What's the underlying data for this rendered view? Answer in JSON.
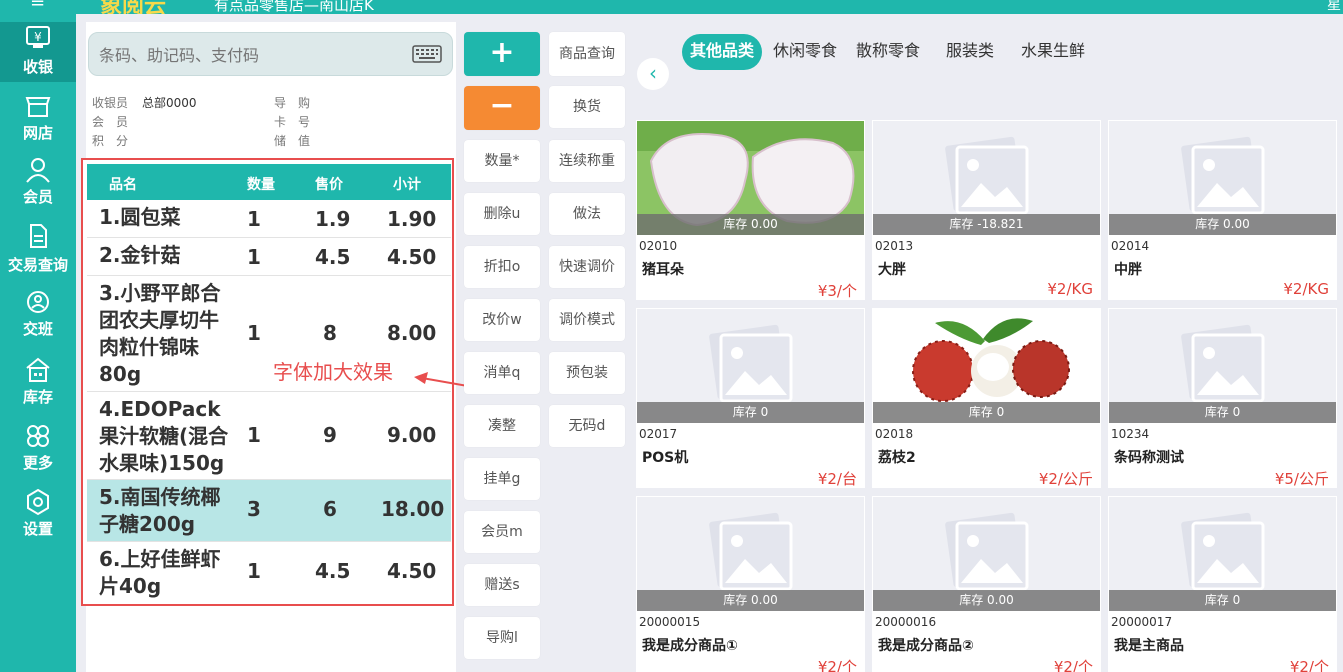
{
  "header": {
    "menu_icon": "hamburger-icon",
    "brand": "象阅云",
    "store": "有点品零售店—南山店K",
    "right_text": "星"
  },
  "nav": [
    {
      "label": "收银",
      "icon": "cashier-icon",
      "active": true
    },
    {
      "label": "网店",
      "icon": "store-icon",
      "active": false
    },
    {
      "label": "会员",
      "icon": "member-icon",
      "active": false
    },
    {
      "label": "交易查询",
      "icon": "document-icon",
      "active": false
    },
    {
      "label": "交班",
      "icon": "shift-icon",
      "active": false
    },
    {
      "label": "库存",
      "icon": "warehouse-icon",
      "active": false
    },
    {
      "label": "更多",
      "icon": "more-icon",
      "active": false
    },
    {
      "label": "设置",
      "icon": "settings-icon",
      "active": false
    }
  ],
  "search": {
    "placeholder": "条码、助记码、支付码",
    "icon": "keyboard-icon"
  },
  "info": {
    "cashier_label": "收银员",
    "cashier_value": "总部0000",
    "guide_label": "导　购",
    "member_label": "会　员",
    "card_label": "卡　号",
    "points_label": "积　分",
    "balance_label": "储　值"
  },
  "cart": {
    "headers": {
      "name": "品名",
      "qty": "数量",
      "price": "售价",
      "subtotal": "小计"
    },
    "rows": [
      {
        "name": "1.圆包菜",
        "qty": "1",
        "price": "1.9",
        "subtotal": "1.90"
      },
      {
        "name": "2.金针菇",
        "qty": "1",
        "price": "4.5",
        "subtotal": "4.50"
      },
      {
        "name": "3.小野平郎合团农夫厚切牛肉粒什锦味80g",
        "qty": "1",
        "price": "8",
        "subtotal": "8.00"
      },
      {
        "name": "4.EDOPack果汁软糖(混合水果味)150g",
        "qty": "1",
        "price": "9",
        "subtotal": "9.00"
      },
      {
        "name": "5.南国传统椰子糖200g",
        "qty": "3",
        "price": "6",
        "subtotal": "18.00"
      },
      {
        "name": "6.上好佳鲜虾片40g",
        "qty": "1",
        "price": "4.5",
        "subtotal": "4.50"
      }
    ]
  },
  "annotation": "字体加大效果",
  "buttons_left": [
    "+",
    "−",
    "数量*",
    "删除u",
    "折扣o",
    "改价w",
    "消单q",
    "凑整",
    "挂单g",
    "会员m",
    "赠送s",
    "导购l"
  ],
  "buttons_right": [
    "商品查询",
    "换货",
    "连续称重",
    "做法",
    "快速调价",
    "调价模式",
    "预包装",
    "无码d"
  ],
  "categories": [
    "其他品类",
    "休闲零食",
    "散称零食",
    "服装类",
    "水果生鲜"
  ],
  "products": [
    {
      "code": "02010",
      "name": "猪耳朵",
      "price": "¥3/个",
      "stock": "库存 0.00",
      "image": "pig-ear"
    },
    {
      "code": "02013",
      "name": "大胖",
      "price": "¥2/KG",
      "stock": "库存 -18.821",
      "image": "placeholder"
    },
    {
      "code": "02014",
      "name": "中胖",
      "price": "¥2/KG",
      "stock": "库存 0.00",
      "image": "placeholder"
    },
    {
      "code": "02017",
      "name": "POS机",
      "price": "¥2/台",
      "stock": "库存 0",
      "image": "placeholder"
    },
    {
      "code": "02018",
      "name": "荔枝2",
      "price": "¥2/公斤",
      "stock": "库存 0",
      "image": "lychee"
    },
    {
      "code": "10234",
      "name": "条码称测试",
      "price": "¥5/公斤",
      "stock": "库存 0",
      "image": "placeholder"
    },
    {
      "code": "20000015",
      "name": "我是成分商品①",
      "price": "¥2/个",
      "stock": "库存 0.00",
      "image": "placeholder"
    },
    {
      "code": "20000016",
      "name": "我是成分商品②",
      "price": "¥2/个",
      "stock": "库存 0.00",
      "image": "placeholder"
    },
    {
      "code": "20000017",
      "name": "我是主商品",
      "price": "¥2/个",
      "stock": "库存 0",
      "image": "placeholder"
    }
  ],
  "colors": {
    "accent": "#1fb7ac",
    "orange": "#f58a33",
    "annotation": "#e84e4e",
    "price": "#e0413a"
  }
}
